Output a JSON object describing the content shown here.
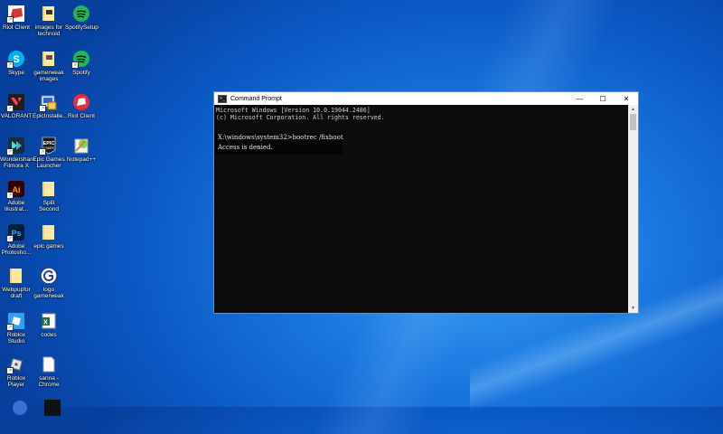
{
  "desktop": {
    "icons": [
      {
        "label": "Riot Client",
        "name": "riot-client-icon"
      },
      {
        "label": "images for technoid",
        "name": "folder-icon"
      },
      {
        "label": "SpotifySetup",
        "name": "spotify-setup-icon"
      },
      {
        "label": "Skype",
        "name": "skype-icon"
      },
      {
        "label": "gamerweak images",
        "name": "folder-icon"
      },
      {
        "label": "Spotify",
        "name": "spotify-icon"
      },
      {
        "label": "VALORANT",
        "name": "valorant-icon"
      },
      {
        "label": "EpicInstalle...",
        "name": "installer-icon"
      },
      {
        "label": "Riot Client",
        "name": "riot-client-icon"
      },
      {
        "label": "Wondershare Filmora X",
        "name": "filmora-icon"
      },
      {
        "label": "Epic Games Launcher",
        "name": "epic-games-icon"
      },
      {
        "label": "Notepad++",
        "name": "notepad-plus-plus-icon"
      },
      {
        "label": "Adobe Illustrat...",
        "name": "adobe-illustrator-icon"
      },
      {
        "label": "Split Second",
        "name": "folder-icon"
      },
      {
        "label": "Adobe Photosho...",
        "name": "adobe-photoshop-icon"
      },
      {
        "label": "epic games",
        "name": "folder-icon"
      },
      {
        "label": "Webpupfor draft",
        "name": "folder-icon"
      },
      {
        "label": "logo gamerweak",
        "name": "gamerweak-logo-icon"
      },
      {
        "label": "Roblox Studio",
        "name": "roblox-studio-icon"
      },
      {
        "label": "codes",
        "name": "excel-icon"
      },
      {
        "label": "Roblox Player",
        "name": "roblox-player-icon"
      },
      {
        "label": "sanna - Chrome",
        "name": "document-icon"
      }
    ]
  },
  "cmd": {
    "title": "Command Prompt",
    "minimize": "—",
    "maximize": "☐",
    "close": "✕",
    "lines": [
      "Microsoft Windows [Version 10.0.19044.2486]",
      "(c) Microsoft Corporation. All rights reserved."
    ],
    "overlay_command": "X:\\windows\\system32>bootrec /fixboot",
    "overlay_result": "Access is denied."
  },
  "colors": {
    "desktop": "#1a78e0",
    "console_bg": "#0c0c0c",
    "console_text": "#cfcfcf"
  }
}
